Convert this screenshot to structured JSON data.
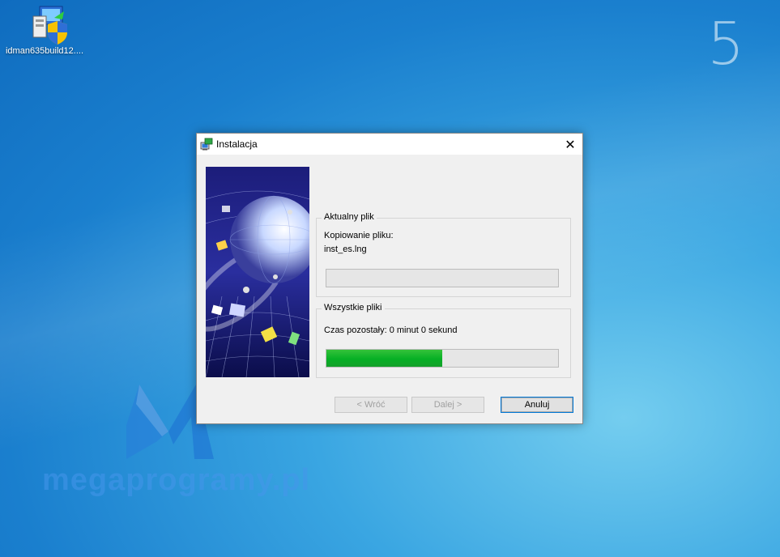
{
  "desktop": {
    "icon_label": "idman635build12....",
    "icon_name": "installer-shield-icon",
    "corner_number": "5",
    "watermark_text": "megaprogramy.pl"
  },
  "dialog": {
    "title": "Instalacja",
    "close_glyph": "✕",
    "current_file_group": {
      "legend": "Aktualny plik",
      "status": "Kopiowanie pliku:",
      "filename": "inst_es.lng",
      "progress": 0
    },
    "all_files_group": {
      "legend": "Wszystkie pliki",
      "remaining": "Czas pozostały: 0 minut 0 sekund",
      "progress": 0.5
    },
    "buttons": {
      "back": "< Wróć",
      "next": "Dalej >",
      "cancel": "Anuluj"
    }
  },
  "colors": {
    "progress_fill": "#06b025",
    "desktop_blue": "#1a7fce"
  }
}
